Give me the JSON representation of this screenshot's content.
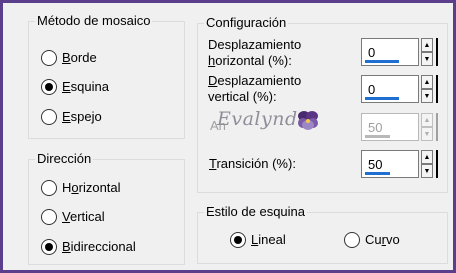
{
  "mosaic_method": {
    "title": "Método de mosaico",
    "options": [
      {
        "label": "Borde",
        "accel": "B",
        "rest": "orde",
        "checked": false
      },
      {
        "label": "Esquina",
        "accel": "E",
        "rest": "squina",
        "checked": true
      },
      {
        "label": "Espejo",
        "accel": "E",
        "rest": "spejo",
        "checked": false
      }
    ]
  },
  "direction": {
    "title": "Dirección",
    "options": [
      {
        "label": "Horizontal",
        "before": "H",
        "accel": "o",
        "rest": "rizontal",
        "checked": false
      },
      {
        "label": "Vertical",
        "accel": "V",
        "rest": "ertical",
        "checked": false
      },
      {
        "label": "Bidireccional",
        "accel": "B",
        "rest": "idireccional",
        "checked": true
      }
    ]
  },
  "config": {
    "title": "Configuración",
    "fields": [
      {
        "line1": "Desplazamiento",
        "line2_accel": "h",
        "line2_rest": "orizontal (%):",
        "value": "0",
        "fill": 0.0,
        "enabled": true
      },
      {
        "line1_accel": "D",
        "line1_rest": "esplazamiento",
        "line2": "vertical (%):",
        "value": "0",
        "fill": 0.0,
        "enabled": true
      },
      {
        "label_partial": "An",
        "value": "50",
        "fill": 0.5,
        "enabled": false
      },
      {
        "label_accel": "T",
        "label_rest": "ransición (%):",
        "value": "50",
        "fill": 0.5,
        "enabled": true
      }
    ]
  },
  "corner_style": {
    "title": "Estilo de esquina",
    "options": [
      {
        "label": "Lineal",
        "accel": "L",
        "rest": "ineal",
        "checked": true
      },
      {
        "label": "Curvo",
        "before": "Cu",
        "accel": "r",
        "rest": "vo",
        "checked": false
      }
    ]
  },
  "watermark": {
    "text": "Evalynda",
    "icon": "pansy-flower-icon"
  }
}
